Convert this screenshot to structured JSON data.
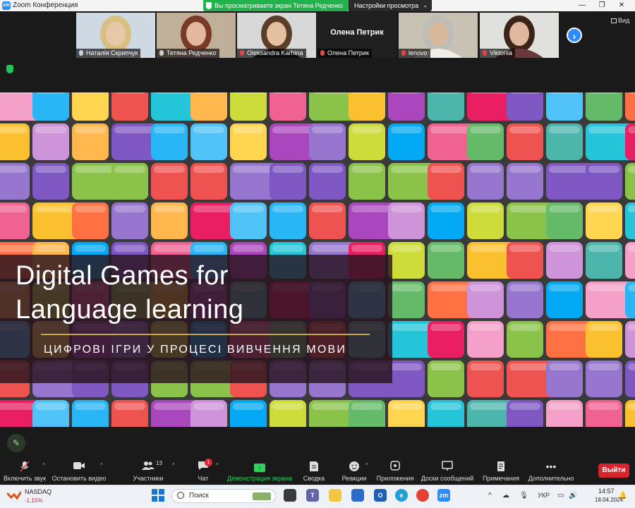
{
  "window": {
    "app_title": "Zoom Конференция",
    "logo_text": "zm",
    "minimize": "—",
    "restore": "❐",
    "close": "✕"
  },
  "share_banner": {
    "text": "Вы просматриваете экран Тетяна Редченко",
    "view_settings": "Настройки просмотра",
    "view_settings_chevron": "⌄"
  },
  "gallery": {
    "participants": [
      {
        "name": "Наталія Скрипчук",
        "muted": false,
        "video": true,
        "bg": "#cfd9e4",
        "face": "#e8c8a8",
        "hair": "#d8c080",
        "shirt": "#f0f0f5"
      },
      {
        "name": "Тетяна Редченко",
        "muted": false,
        "video": true,
        "bg": "#bfae98",
        "face": "#e4b89c",
        "hair": "#7a3a2a",
        "shirt": "#caa49a"
      },
      {
        "name": "Oleksandra Karhina",
        "muted": true,
        "video": true,
        "bg": "#d8d8d8",
        "face": "#e4c0a0",
        "hair": "#5a3e2a",
        "shirt": "#1a1a1a"
      },
      {
        "name": "Олена Петрик",
        "muted": true,
        "video": false,
        "display_name": "Олена Петрик"
      },
      {
        "name": "lenovo",
        "muted": true,
        "video": true,
        "bg": "#c7c2b4",
        "face": "#d8b89a",
        "hair": "#bdbdb8",
        "shirt": "#efefe8"
      },
      {
        "name": "Viktoriia",
        "muted": true,
        "video": true,
        "bg": "#e0e0dc",
        "face": "#e0b8a0",
        "hair": "#3a2418",
        "shirt": "#6a3a3a"
      }
    ],
    "next_icon": "›",
    "view_label": "Вид"
  },
  "slide": {
    "title_line1": "Digital Games for",
    "title_line2": "Language learning",
    "subtitle": "ЦИФРОВІ ІГРИ У ПРОЦЕСІ ВИВЧЕННЯ МОВИ"
  },
  "annotate_icon": "✎",
  "toolbar": {
    "unmute": "Включить звук",
    "video": "Остановить видео",
    "participants": "Участники",
    "participants_count": "13",
    "chat": "Чат",
    "chat_badge": "1",
    "share": "Демонстрация экрана",
    "summary": "Сводка",
    "reactions": "Реакции",
    "apps": "Приложения",
    "whiteboards": "Доски сообщений",
    "notes": "Примечания",
    "more": "Дополнительно",
    "leave": "Выйти",
    "caret": "^"
  },
  "taskbar": {
    "stock_name": "NASDAQ",
    "stock_change": "-1.15%",
    "search_placeholder": "Поиск",
    "lang": "УКР",
    "time": "14:57",
    "date": "18.04.2024"
  }
}
